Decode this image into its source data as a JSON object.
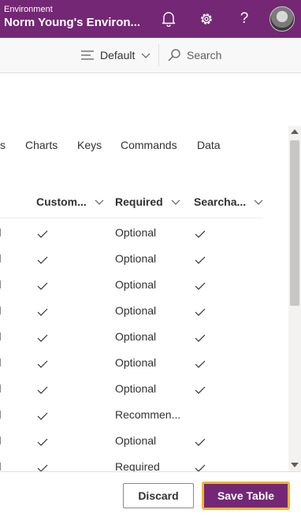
{
  "header": {
    "env_label": "Environment",
    "env_name": "Norm Young's Environ...",
    "help_glyph": "?",
    "icons": [
      "bell-icon",
      "gear-icon",
      "help-icon"
    ],
    "avatar": "user-avatar",
    "bg_color": "#742774"
  },
  "commandbar": {
    "view_label": "Default",
    "search_label": "Search"
  },
  "tabs": [
    "s",
    "Charts",
    "Keys",
    "Commands",
    "Data"
  ],
  "columns": [
    "Custom...",
    "Required",
    "Searcha..."
  ],
  "rows": [
    {
      "custom": true,
      "required": "Optional",
      "searchable": true
    },
    {
      "custom": true,
      "required": "Optional",
      "searchable": true
    },
    {
      "custom": true,
      "required": "Optional",
      "searchable": true
    },
    {
      "custom": true,
      "required": "Optional",
      "searchable": true
    },
    {
      "custom": true,
      "required": "Optional",
      "searchable": true
    },
    {
      "custom": true,
      "required": "Optional",
      "searchable": true
    },
    {
      "custom": true,
      "required": "Optional",
      "searchable": true
    },
    {
      "custom": true,
      "required": "Recommen...",
      "searchable": false
    },
    {
      "custom": true,
      "required": "Optional",
      "searchable": true
    },
    {
      "custom": true,
      "required": "Required",
      "searchable": true
    }
  ],
  "footer": {
    "discard_label": "Discard",
    "save_label": "Save Table",
    "save_color": "#742774",
    "focus_color": "#f2b233"
  }
}
